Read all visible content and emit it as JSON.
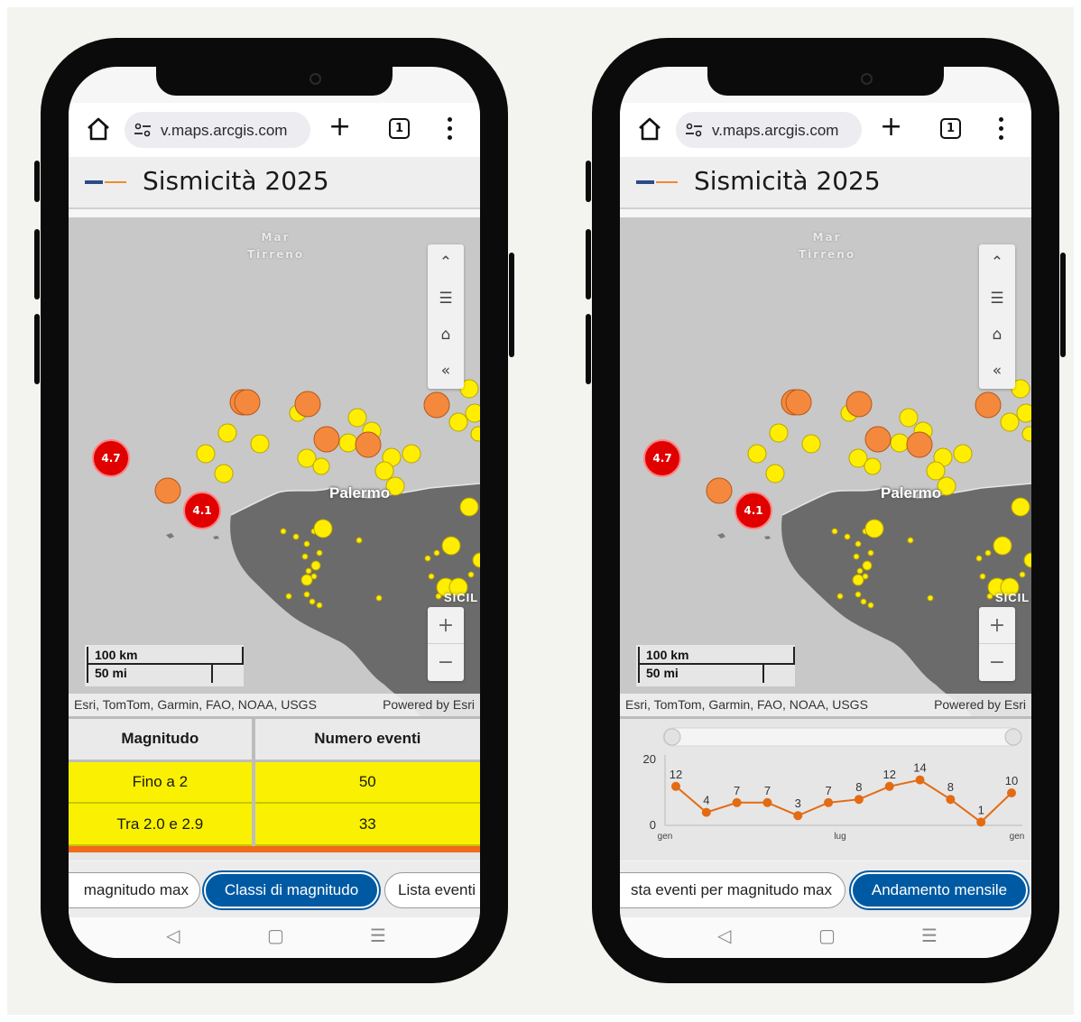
{
  "browser": {
    "url": "v.maps.arcgis.com",
    "tab_count": "1"
  },
  "app": {
    "title": "Sismicità 2025"
  },
  "map": {
    "sea_label_line1": "Mar",
    "sea_label_line2": "Tirreno",
    "city_label": "Palermo",
    "region_label": "SICIL",
    "clusters": [
      "4.7",
      "4.1"
    ],
    "scale_km": "100 km",
    "scale_mi": "50 mi",
    "attribution": "Esri, TomTom, Garmin, FAO, NOAA, USGS",
    "powered_by": "Powered by Esri",
    "controls": {
      "collapse": "«",
      "zoom_in": "+",
      "zoom_out": "−"
    }
  },
  "phone1": {
    "table": {
      "headers": [
        "Magnitudo",
        "Numero eventi"
      ],
      "rows": [
        {
          "magnitudo": "Fino a 2",
          "eventi": "50"
        },
        {
          "magnitudo": "Tra 2.0 e 2.9",
          "eventi": "33"
        }
      ]
    },
    "tabs": {
      "tab1": "magnitudo max",
      "tab2": "Classi di magnitudo",
      "tab3": "Lista eventi"
    }
  },
  "phone2": {
    "tabs": {
      "tab1": "sta eventi per magnitudo max",
      "tab2": "Andamento mensile"
    }
  },
  "colors": {
    "accent": "#005aa3",
    "class1_yellow": "#f9f101",
    "class2_orange": "#f26a1b",
    "cluster_red": "#e00000",
    "line_orange": "#e36b13"
  },
  "chart_data": {
    "type": "line",
    "title": "",
    "xlabel": "",
    "ylabel": "",
    "y_ticks": [
      "20",
      "0"
    ],
    "x_ticks": [
      "gen",
      "lug",
      "gen"
    ],
    "ylim": [
      0,
      20
    ],
    "values": [
      12,
      4,
      7,
      7,
      3,
      7,
      8,
      12,
      14,
      8,
      1,
      10
    ],
    "labels": [
      "12",
      "4",
      "7",
      "7",
      "3",
      "7",
      "8",
      "12",
      "14",
      "8",
      "1",
      "10"
    ]
  }
}
